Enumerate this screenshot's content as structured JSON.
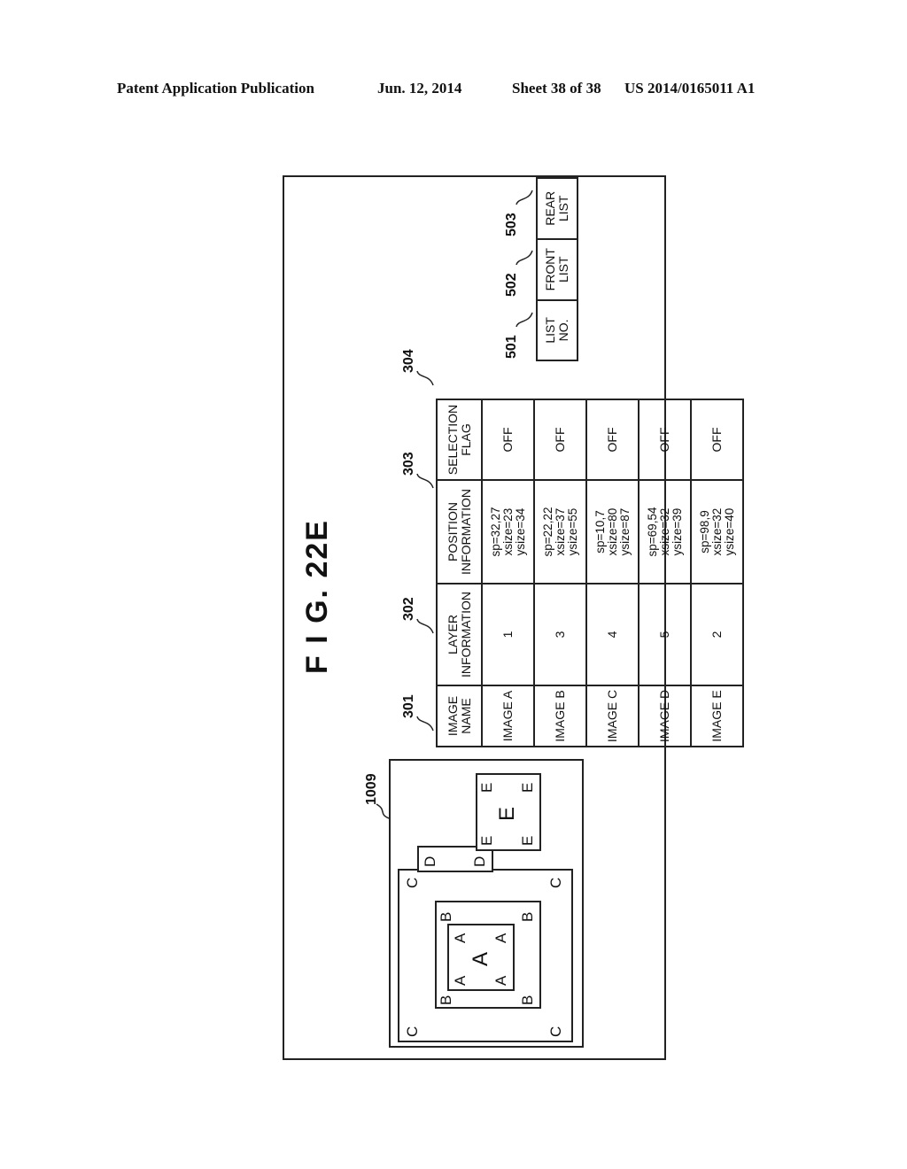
{
  "header": {
    "publication": "Patent Application Publication",
    "date": "Jun. 12, 2014",
    "sheet": "Sheet 38 of 38",
    "number": "US 2014/0165011 A1"
  },
  "figure": {
    "title": "F I G.  22E",
    "screen_ref": "1009",
    "screen_images": {
      "A": "A",
      "B": "B",
      "C": "C",
      "D": "D",
      "E": "E"
    },
    "image_table": {
      "refs": [
        "301",
        "302",
        "303",
        "304"
      ],
      "headers": [
        [
          "IMAGE",
          "NAME"
        ],
        [
          "LAYER",
          "INFORMATION"
        ],
        [
          "POSITION",
          "INFORMATION"
        ],
        [
          "SELECTION",
          "FLAG"
        ]
      ],
      "rows": [
        {
          "name": "IMAGE A",
          "layer": "1",
          "position": [
            "sp=32,27",
            "xsize=23",
            "ysize=34"
          ],
          "flag": "OFF"
        },
        {
          "name": "IMAGE B",
          "layer": "3",
          "position": [
            "sp=22,22",
            "xsize=37",
            "ysize=55"
          ],
          "flag": "OFF"
        },
        {
          "name": "IMAGE C",
          "layer": "4",
          "position": [
            "sp=10,7",
            "xsize=80",
            "ysize=87"
          ],
          "flag": "OFF"
        },
        {
          "name": "IMAGE D",
          "layer": "5",
          "position": [
            "sp=69,54",
            "xsize=32",
            "ysize=39"
          ],
          "flag": "OFF"
        },
        {
          "name": "IMAGE E",
          "layer": "2",
          "position": [
            "sp=98,9",
            "xsize=32",
            "ysize=40"
          ],
          "flag": "OFF"
        }
      ]
    },
    "list_table": {
      "refs": [
        "501",
        "502",
        "503"
      ],
      "headers": [
        [
          "LIST",
          "NO."
        ],
        [
          "FRONT",
          "LIST"
        ],
        [
          "REAR",
          "LIST"
        ]
      ]
    }
  }
}
